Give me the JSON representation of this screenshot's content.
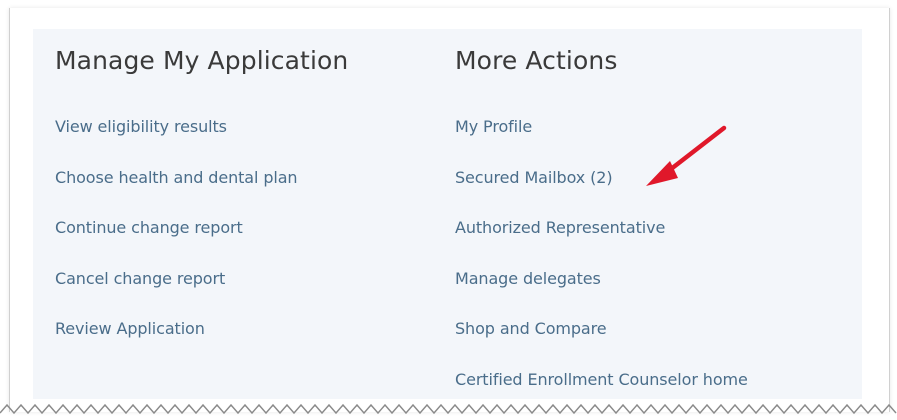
{
  "manage_section": {
    "title": "Manage My Application",
    "links": [
      {
        "label": "View eligibility results"
      },
      {
        "label": "Choose health and dental plan"
      },
      {
        "label": "Continue change report"
      },
      {
        "label": "Cancel change report"
      },
      {
        "label": "Review Application"
      }
    ]
  },
  "actions_section": {
    "title": "More Actions",
    "links": [
      {
        "label": "My Profile"
      },
      {
        "label": "Secured Mailbox (2)"
      },
      {
        "label": "Authorized Representative"
      },
      {
        "label": "Manage delegates"
      },
      {
        "label": "Shop and Compare"
      },
      {
        "label": "Certified Enrollment Counselor home"
      }
    ]
  },
  "annotation": {
    "arrow_icon": "red-arrow-icon",
    "arrow_color": "#e0182a"
  },
  "colors": {
    "panel_background": "#f3f6fa",
    "link": "#4a6d8a",
    "heading": "#3a3a3a"
  }
}
